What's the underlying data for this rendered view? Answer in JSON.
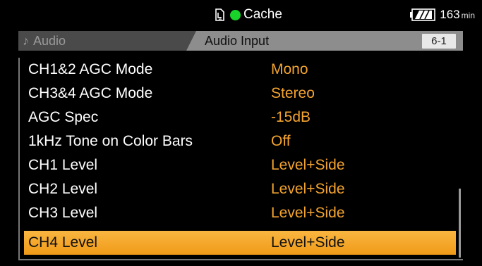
{
  "status": {
    "media_label": "Cache",
    "battery_value": "163",
    "battery_unit": "min",
    "colors": {
      "cache_indicator": "#19d32a",
      "accent": "#f3a430"
    },
    "icons": {
      "media": "media-card-icon",
      "battery": "battery-icon"
    }
  },
  "header": {
    "section_label": "Audio",
    "section_icon": "music-note-icon",
    "page_title": "Audio Input",
    "page_number": "6-1"
  },
  "menu": {
    "items": [
      {
        "label": "CH1&2 AGC Mode",
        "value": "Mono"
      },
      {
        "label": "CH3&4 AGC Mode",
        "value": "Stereo"
      },
      {
        "label": "AGC Spec",
        "value": "-15dB"
      },
      {
        "label": "1kHz Tone on Color Bars",
        "value": "Off"
      },
      {
        "label": "CH1 Level",
        "value": "Level+Side"
      },
      {
        "label": "CH2 Level",
        "value": "Level+Side"
      },
      {
        "label": "CH3 Level",
        "value": "Level+Side"
      },
      {
        "label": "CH4 Level",
        "value": "Level+Side",
        "selected": true
      }
    ]
  }
}
